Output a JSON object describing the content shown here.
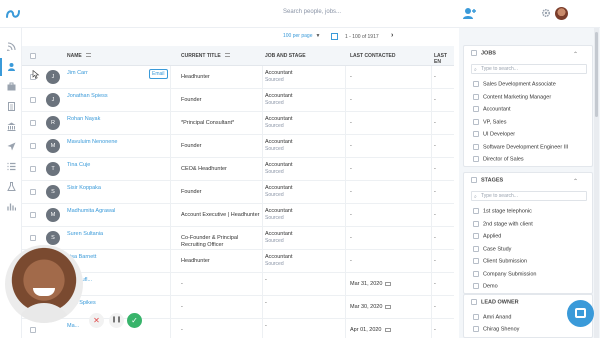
{
  "topbar": {
    "search_placeholder": "Search people, jobs...",
    "icons": [
      "logo-icon",
      "add-user-icon",
      "gear-icon",
      "avatar"
    ]
  },
  "sidebar": {
    "items": [
      {
        "icon": "rss-icon"
      },
      {
        "icon": "person-icon",
        "active": true
      },
      {
        "icon": "briefcase-icon"
      },
      {
        "icon": "document-icon"
      },
      {
        "icon": "bank-icon"
      },
      {
        "icon": "send-icon"
      },
      {
        "icon": "list-icon"
      },
      {
        "icon": "flask-icon"
      },
      {
        "icon": "bar-chart-icon"
      }
    ]
  },
  "pager": {
    "per_page": "100 per page",
    "range": "1 - 100 of 1917"
  },
  "table": {
    "headers": {
      "name": "NAME",
      "current_title": "CURRENT TITLE",
      "job_and_stage": "JOB AND STAGE",
      "last_contacted": "LAST CONTACTED",
      "last_e": "LAST EN"
    },
    "email_button": "Email",
    "rows": [
      {
        "initial": "J",
        "name": "Jim Carr",
        "title": "Headhunter",
        "job": "Accountant",
        "stage": "Sourced",
        "last": "-",
        "laste": "-"
      },
      {
        "initial": "J",
        "name": "Jonathan Spiess",
        "title": "Founder",
        "job": "Accountant",
        "stage": "Sourced",
        "last": "-",
        "laste": "-"
      },
      {
        "initial": "R",
        "name": "Rohan Nayak",
        "title": "*Principal Consultant*",
        "job": "Accountant",
        "stage": "Sourced",
        "last": "-",
        "laste": "-"
      },
      {
        "initial": "M",
        "name": "Mavuluim Nenonene",
        "title": "Founder",
        "job": "Accountant",
        "stage": "Sourced",
        "last": "-",
        "laste": "-"
      },
      {
        "initial": "T",
        "name": "Tina Cuje",
        "title": "CEO& Headhunter",
        "job": "Accountant",
        "stage": "Sourced",
        "last": "-",
        "laste": "-"
      },
      {
        "initial": "S",
        "name": "Sisir Koppaka",
        "title": "Founder",
        "job": "Accountant",
        "stage": "Sourced",
        "last": "-",
        "laste": "-"
      },
      {
        "initial": "M",
        "name": "Madhumita Agrawal",
        "title": "Account Executive | Headhunter",
        "job": "Accountant",
        "stage": "Sourced",
        "last": "-",
        "laste": "-"
      },
      {
        "initial": "S",
        "name": "Suren Sultania",
        "title": "Co-Founder & Principal Recruiting Officer",
        "job": "Accountant",
        "stage": "Sourced",
        "last": "-",
        "laste": "-"
      },
      {
        "initial": "L",
        "name": "Lisa Barnett",
        "title": "Headhunter",
        "job": "Accountant",
        "stage": "Sourced",
        "last": "-",
        "laste": "-"
      },
      {
        "initial": "",
        "name": "...t Haufl...",
        "title": "-",
        "job": "-",
        "stage": "",
        "last": "Mar 31, 2020",
        "laste": "-"
      },
      {
        "initial": "",
        "name": "...da Spikes",
        "title": "-",
        "job": "-",
        "stage": "",
        "last": "Mar 30, 2020",
        "laste": "-"
      },
      {
        "initial": "",
        "name": "Ma...",
        "title": "-",
        "job": "-",
        "stage": "",
        "last": "Apr 01, 2020",
        "laste": "-"
      }
    ]
  },
  "filters": {
    "filter_placeholder": "Type to search...",
    "jobs": {
      "title": "JOBS",
      "options": [
        "Sales Development Associate",
        "Content Marketing Manager",
        "Accountant",
        "VP, Sales",
        "UI Developer",
        "Software Development Engineer III",
        "Director of Sales"
      ]
    },
    "stages": {
      "title": "STAGES",
      "options": [
        "1st stage telephonic",
        "2nd stage with client",
        "Applied",
        "Case Study",
        "Client Submission",
        "Company Submission",
        "Demo"
      ]
    },
    "lead_owner": {
      "title": "LEAD OWNER",
      "options": [
        "Amri Anand",
        "Chirag Shenoy"
      ]
    }
  },
  "colors": {
    "accent": "#3a9ad9",
    "avatar_bg": "#6b737d",
    "panel_bg": "#f3f6f9",
    "success": "#38b46b",
    "danger": "#e04848"
  }
}
